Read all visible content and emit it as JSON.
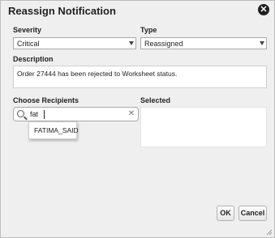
{
  "dialog": {
    "title": "Reassign Notification"
  },
  "severity": {
    "label": "Severity",
    "value": "Critical"
  },
  "type": {
    "label": "Type",
    "value": "Reassigned"
  },
  "description": {
    "label": "Description",
    "value": "Order 27444 has been rejected to Worksheet status."
  },
  "recipients": {
    "label": "Choose Recipients",
    "search_value": "fat",
    "suggestions": [
      "FATIMA_SAID"
    ]
  },
  "selected": {
    "label": "Selected"
  },
  "buttons": {
    "ok": "OK",
    "cancel": "Cancel"
  },
  "icons": {
    "close": "close-icon",
    "search": "search-icon",
    "clear": "clear-icon"
  }
}
